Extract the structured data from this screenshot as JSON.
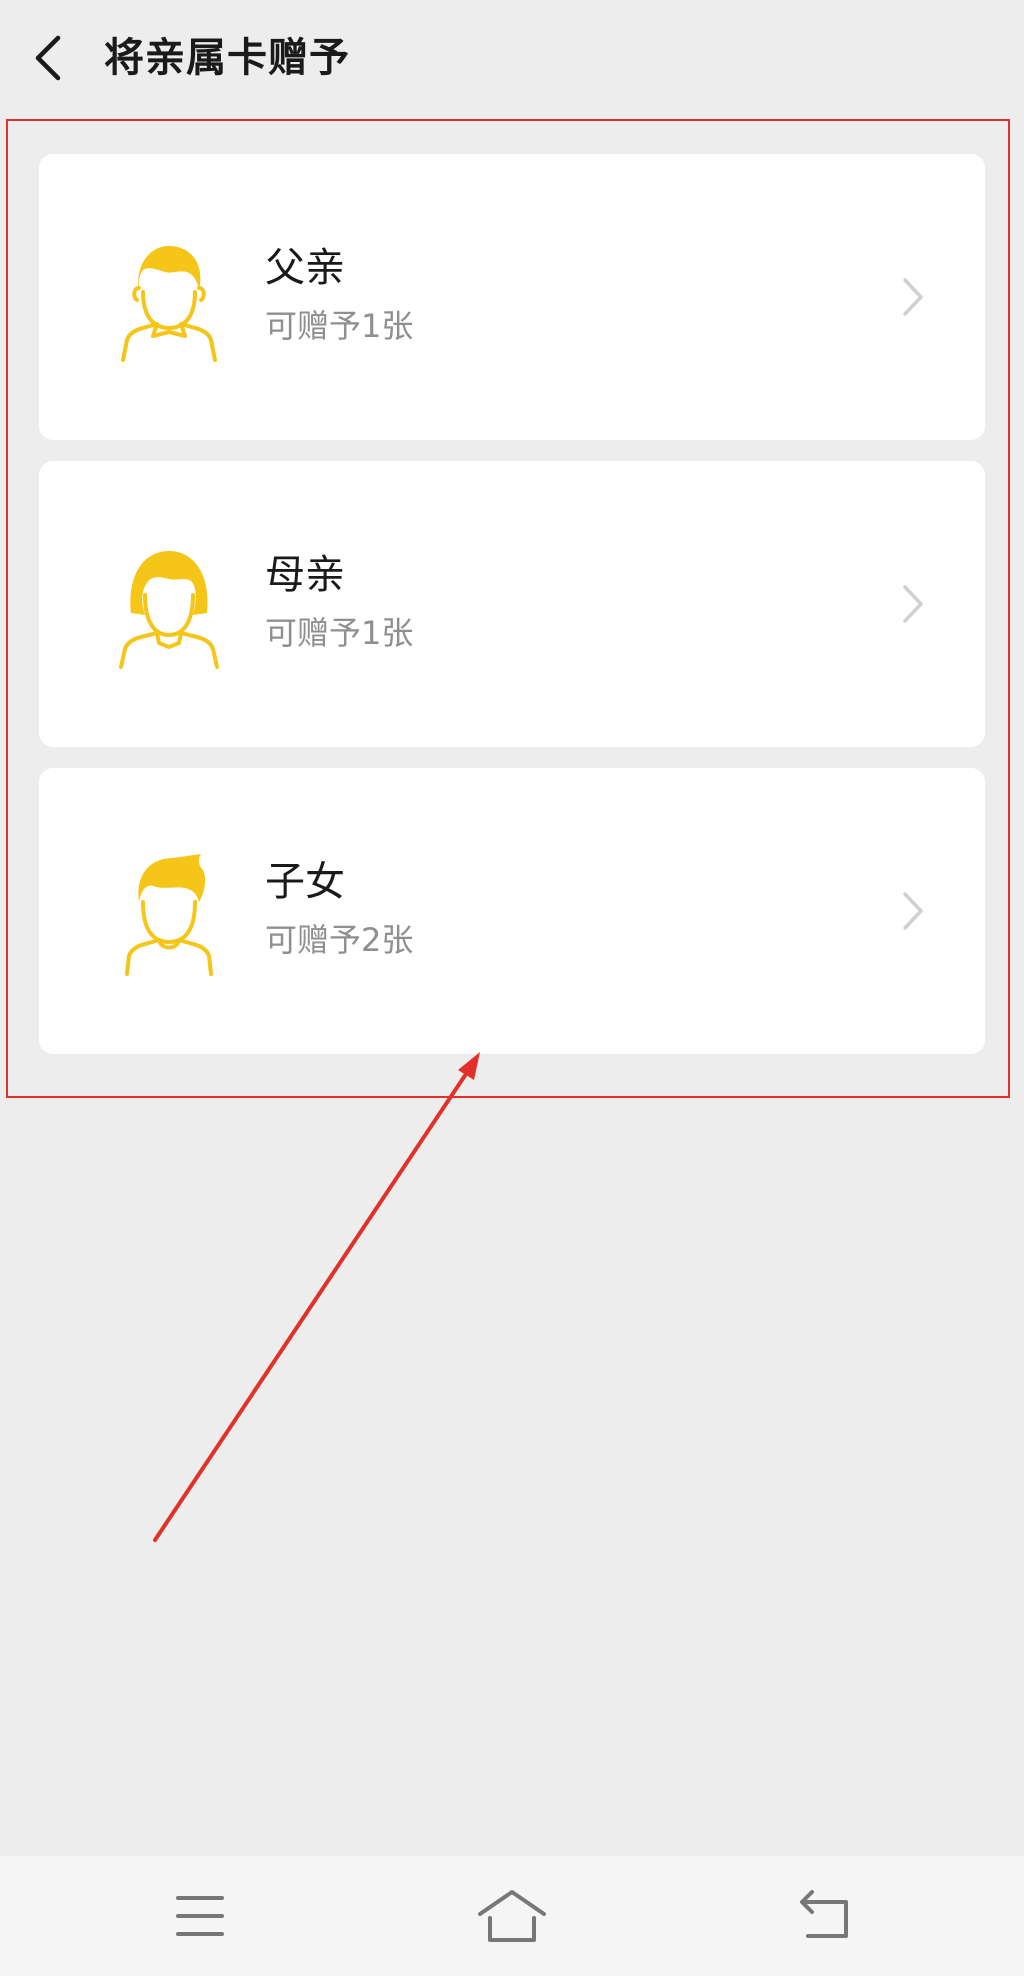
{
  "header": {
    "title": "将亲属卡赠予",
    "back_icon": "back-chevron-icon"
  },
  "colors": {
    "background": "#ededed",
    "card": "#ffffff",
    "avatar_accent": "#f5c518",
    "highlight": "#e2302a",
    "subtext": "#8f8f8f"
  },
  "recipients": [
    {
      "name": "父亲",
      "subtitle": "可赠予1张",
      "icon": "father-avatar-icon"
    },
    {
      "name": "母亲",
      "subtitle": "可赠予1张",
      "icon": "mother-avatar-icon"
    },
    {
      "name": "子女",
      "subtitle": "可赠予2张",
      "icon": "child-avatar-icon"
    }
  ],
  "nav": {
    "items": [
      "menu-icon",
      "home-icon",
      "return-icon"
    ]
  }
}
